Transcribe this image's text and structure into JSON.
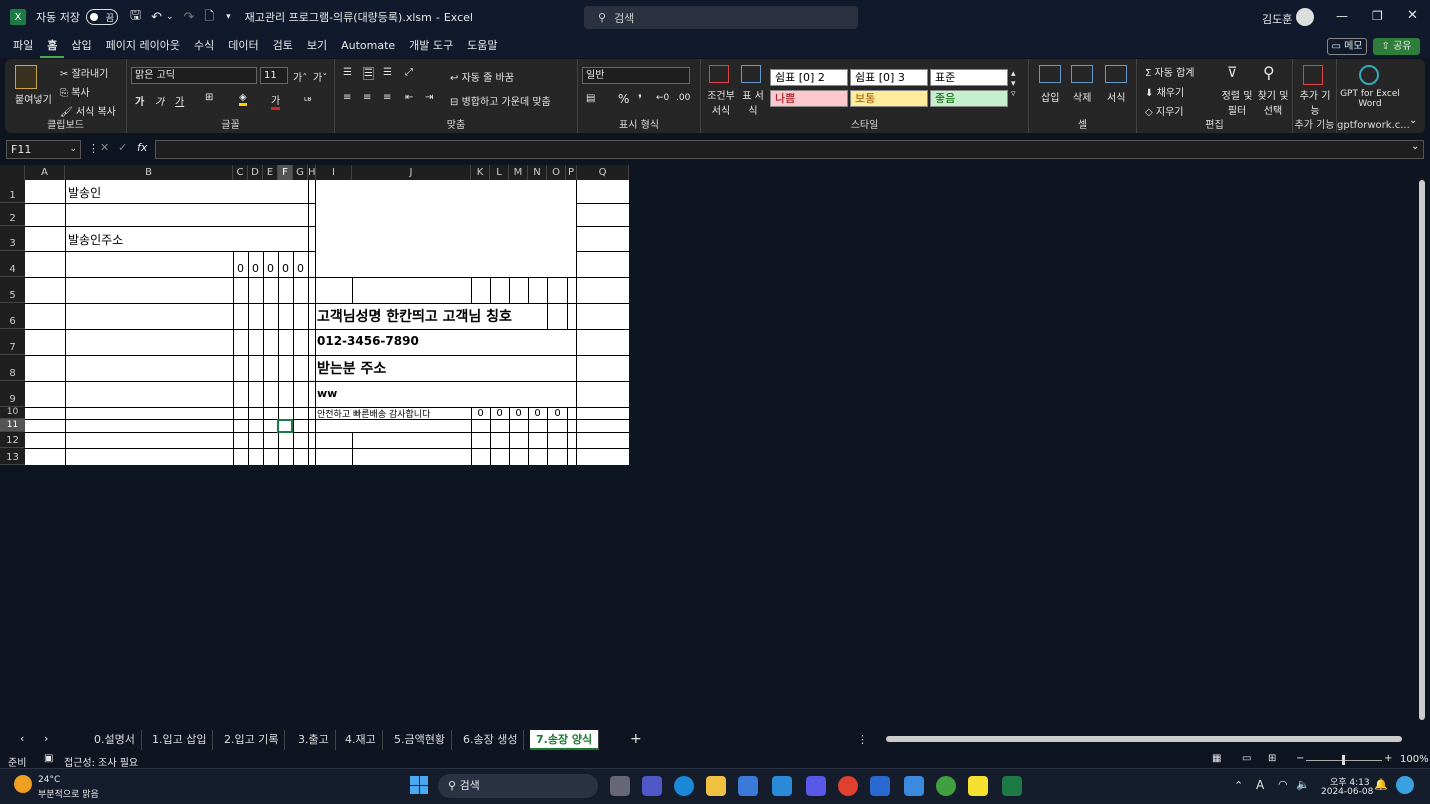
{
  "title": {
    "autosave_label": "자동 저장",
    "toggle_state": "끔",
    "filename": "재고관리 프로그램-의류(대량등록).xlsm",
    "app": "Excel",
    "search_placeholder": "검색",
    "user": "김도훈"
  },
  "menu": {
    "tabs": [
      "파일",
      "홈",
      "삽입",
      "페이지 레이아웃",
      "수식",
      "데이터",
      "검토",
      "보기",
      "Automate",
      "개발 도구",
      "도움말"
    ],
    "memo_label": "메모",
    "share_label": "공유"
  },
  "ribbon": {
    "clipboard": {
      "paste": "붙여넣기",
      "cut": "잘라내기",
      "copy": "복사",
      "format_painter": "서식 복사",
      "label": "클립보드"
    },
    "font": {
      "name": "맑은 고딕",
      "size": "11",
      "label": "글꼴"
    },
    "align": {
      "wrap": "자동 줄 바꿈",
      "merge": "병합하고 가운데 맞춤",
      "label": "맞춤"
    },
    "number": {
      "format": "일반",
      "label": "표시 형식"
    },
    "styles": {
      "cond": "조건부 서식",
      "table": "표 서식",
      "cells": [
        "쉼표 [0] 2",
        "쉼표 [0] 3",
        "표준",
        "나쁨",
        "보통",
        "좋음"
      ],
      "label": "스타일"
    },
    "cells": {
      "insert": "삽입",
      "delete": "삭제",
      "format": "서식",
      "label": "셀"
    },
    "edit": {
      "autosum": "자동 합계",
      "fill": "채우기",
      "clear": "지우기",
      "sort": "정렬 및 필터",
      "find": "찾기 및 선택",
      "label": "편집"
    },
    "addins": {
      "btn": "추가 기능",
      "label": "추가 기능"
    },
    "gpt": {
      "btn": "GPT for Excel Word",
      "label": "gptforwork.c..."
    }
  },
  "formula_bar": {
    "name_box": "F11",
    "fx": "fx",
    "value": ""
  },
  "columns": [
    "A",
    "B",
    "C",
    "D",
    "E",
    "F",
    "G",
    "H",
    "I",
    "J",
    "K",
    "L",
    "M",
    "N",
    "O",
    "P",
    "Q"
  ],
  "rows": [
    "1",
    "2",
    "3",
    "4",
    "5",
    "6",
    "7",
    "8",
    "9",
    "10",
    "11",
    "12",
    "13"
  ],
  "sheet": {
    "b1": "발송인",
    "b3": "발송인주소",
    "zeros_row4": [
      "0",
      "0",
      "0",
      "0",
      "0"
    ],
    "j6": "고객님성명 한칸띄고 고객님 칭호",
    "j7": "012-3456-7890",
    "j8": "받는분 주소",
    "j9": "ww",
    "j10": "안전하고 빠른배송 감사합니다",
    "zeros_row10": [
      "0",
      "0",
      "0",
      "0",
      "0"
    ]
  },
  "sheet_tabs": [
    "0.설명서",
    "1.입고 삽입",
    "2.입고 기록",
    "3.출고",
    "4.재고",
    "5.금액현황",
    "6.송장 생성",
    "7.송장 양식"
  ],
  "status": {
    "ready": "준비",
    "accessibility": "접근성: 조사 필요",
    "zoom": "100%"
  },
  "taskbar": {
    "temp": "24°C",
    "weather": "부분적으로 맑음",
    "search": "검색",
    "time": "오후 4:13",
    "date": "2024-06-08"
  }
}
